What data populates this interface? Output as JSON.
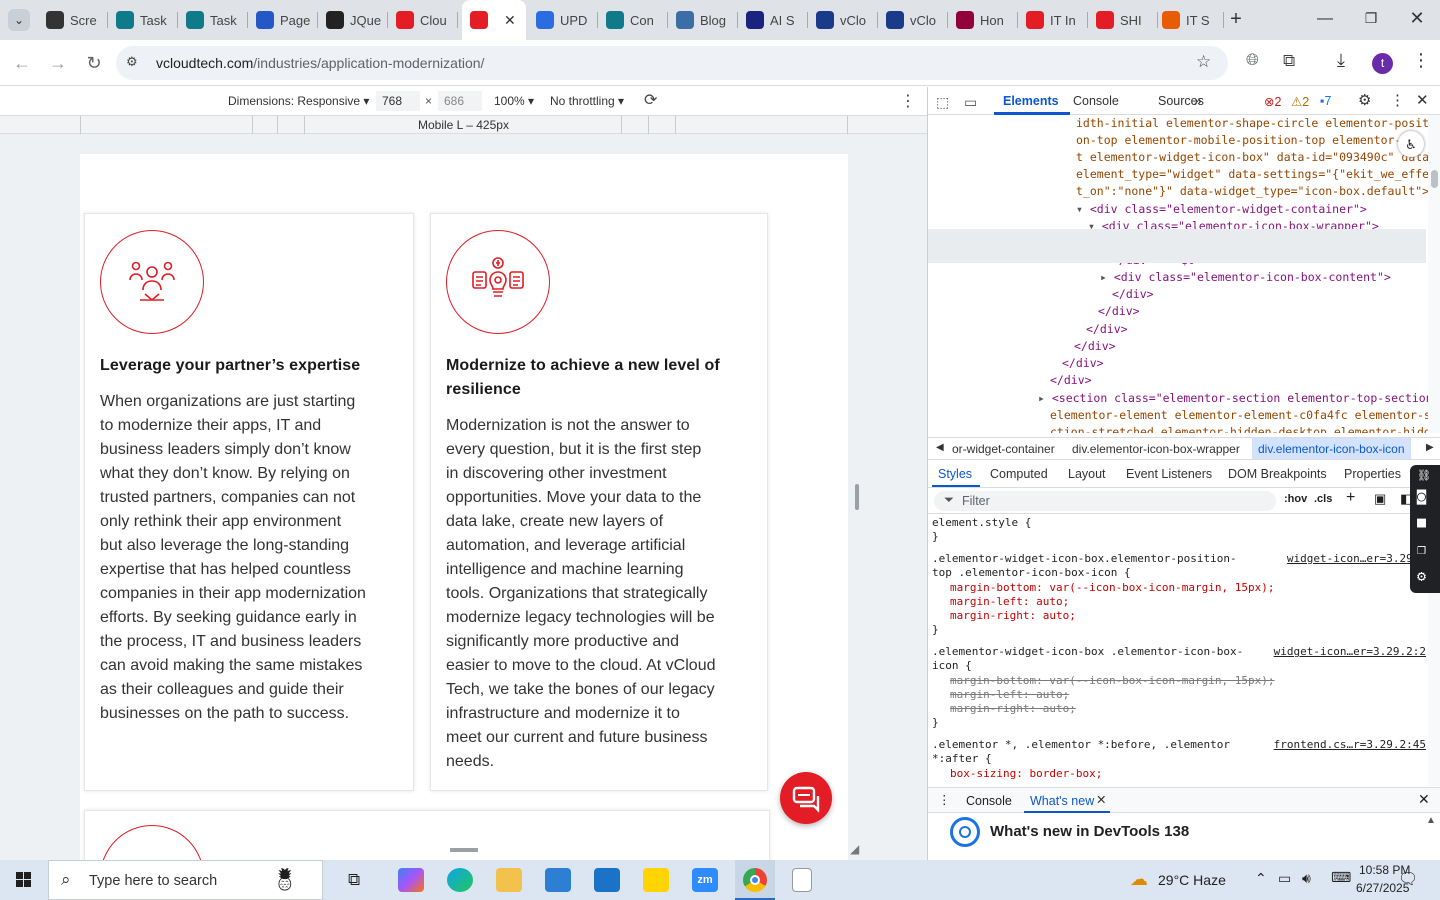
{
  "browser": {
    "tabs": [
      {
        "label": "Scre",
        "icon": "settings-icon",
        "color": "#333333"
      },
      {
        "label": "Task",
        "icon": "task-icon",
        "color": "#0f7b8a"
      },
      {
        "label": "Task",
        "icon": "task-icon",
        "color": "#0f7b8a"
      },
      {
        "label": "Page",
        "icon": "speed-icon",
        "color": "#2458c6"
      },
      {
        "label": "JQue",
        "icon": "openai-icon",
        "color": "#222222"
      },
      {
        "label": "Clou",
        "icon": "vcloud-icon",
        "color": "#e31c25"
      },
      {
        "label": "",
        "icon": "vcloud-icon",
        "color": "#e31c25",
        "active": true
      },
      {
        "label": "UPD",
        "icon": "doc-icon",
        "color": "#2b6de0"
      },
      {
        "label": "Con",
        "icon": "task-icon",
        "color": "#0f7b8a"
      },
      {
        "label": "Blog",
        "icon": "admin-icon",
        "color": "#3a6ea5"
      },
      {
        "label": "AI S",
        "icon": "ai-icon",
        "color": "#1a237e"
      },
      {
        "label": "vClo",
        "icon": "vcloud-icon",
        "color": "#1a3a8a"
      },
      {
        "label": "vClo",
        "icon": "vcloud-icon",
        "color": "#1a3a8a"
      },
      {
        "label": "Hon",
        "icon": "elementor-icon",
        "color": "#92003b"
      },
      {
        "label": "IT In",
        "icon": "vcloud-icon",
        "color": "#e31c25"
      },
      {
        "label": "SHI",
        "icon": "shi-icon",
        "color": "#e31c25"
      },
      {
        "label": "IT S",
        "icon": "pen-icon",
        "color": "#e85d04"
      }
    ],
    "url_host": "vcloudtech.com",
    "url_path": "/industries/application-modernization/",
    "profile_initial": "t"
  },
  "device_toolbar": {
    "dimensions_label": "Dimensions: Responsive",
    "width": "768",
    "times": "×",
    "height": "686",
    "zoom": "100%",
    "throttling": "No throttling",
    "media_query_label": "Mobile L – 425px"
  },
  "page": {
    "cards": [
      {
        "title": "Leverage your partner’s expertise",
        "body": [
          "When organizations are just starting",
          "to modernize their apps, IT and",
          "business leaders simply don’t know",
          "what they don’t know. By relying on",
          "trusted partners, companies can not",
          "only rethink their app environment",
          "but also leverage the long-standing",
          "expertise that has helped countless",
          "companies in their app modernization",
          "efforts. By seeking guidance early in",
          "the process, IT and business leaders",
          "can avoid making the same mistakes",
          "as their colleagues and guide their",
          "businesses on the path to success."
        ]
      },
      {
        "title_lines": [
          "Modernize to achieve a new level of",
          "resilience"
        ],
        "body": [
          "Modernization is not the answer to",
          "every question, but it is the first step",
          "in discovering other investment",
          "opportunities. Move your data to the",
          "data lake, create new layers of",
          "automation, and leverage artificial",
          "intelligence and machine learning",
          "tools. Organizations that strategically",
          "modernize legacy technologies will be",
          "significantly more productive and",
          "easier to move to the cloud. At vCloud",
          "Tech, we take the bones of our legacy",
          "infrastructure and modernize it to",
          "meet our current and future business",
          "needs."
        ]
      }
    ],
    "accent": "#e31c25"
  },
  "devtools": {
    "tabs": [
      "Elements",
      "Console",
      "Sources"
    ],
    "errors": "2",
    "warnings": "2",
    "messages": "7",
    "dom_lines": [
      "idth-initial elementor-shape-circle elementor-positi",
      "on-top elementor-mobile-position-top elementor-w",
      "t elementor-widget-icon-box\" data-id=\"093490c\" data-",
      "element_type=\"widget\" data-settings=\"{\"ekit_we_effec",
      "t_on\":\"none\"}\" data-widget_type=\"icon-box.default\">",
      "<div class=\"elementor-widget-container\">",
      "<div class=\"elementor-icon-box-wrapper\">",
      "<div class=\"elementor-icon-box-icon\">",
      "</div> == $0",
      "<div class=\"elementor-icon-box-content\">",
      "</div>",
      "</div>",
      "</div>",
      "</div>",
      "</div>",
      "</div>",
      "<section class=\"elementor-section elementor-top-section",
      "elementor-element elementor-element-c0fa4fc elementor-se",
      "ction-stretched elementor-hidden-desktop elementor-hidde"
    ],
    "breadcrumbs": [
      "or-widget-container",
      "div.elementor-icon-box-wrapper",
      "div.elementor-icon-box-icon"
    ],
    "subtabs": [
      "Styles",
      "Computed",
      "Layout",
      "Event Listeners",
      "DOM Breakpoints",
      "Properties"
    ],
    "filter_placeholder": "Filter",
    "hov": ":hov",
    "cls": ".cls",
    "style_lines": [
      "element.style {",
      "}",
      ".elementor-widget-icon-box.elementor-position-",
      "top .elementor-icon-box-icon {",
      "margin-bottom: var(--icon-box-icon-margin, 15px);",
      "margin-left: auto;",
      "margin-right: auto;",
      "}",
      ".elementor-widget-icon-box .elementor-icon-box-",
      "icon {",
      "margin-bottom: var(--icon-box-icon-margin, 15px);",
      "margin-left: auto;",
      "margin-right: auto;",
      "}",
      ".elementor *, .elementor *:before, .elementor",
      "*:after {",
      "box-sizing: border-box;"
    ],
    "style_sources": [
      "widget-icon…er=3.29.2",
      "widget-icon…er=3.29.2:2",
      "frontend.cs…r=3.29.2:45"
    ],
    "drawer_tabs": [
      "Console",
      "What's new"
    ],
    "whats_new_title": "What's new in DevTools 138"
  },
  "taskbar": {
    "search_placeholder": "Type here to search",
    "weather": "29°C  Haze",
    "time": "10:58 PM",
    "date": "6/27/2025"
  }
}
